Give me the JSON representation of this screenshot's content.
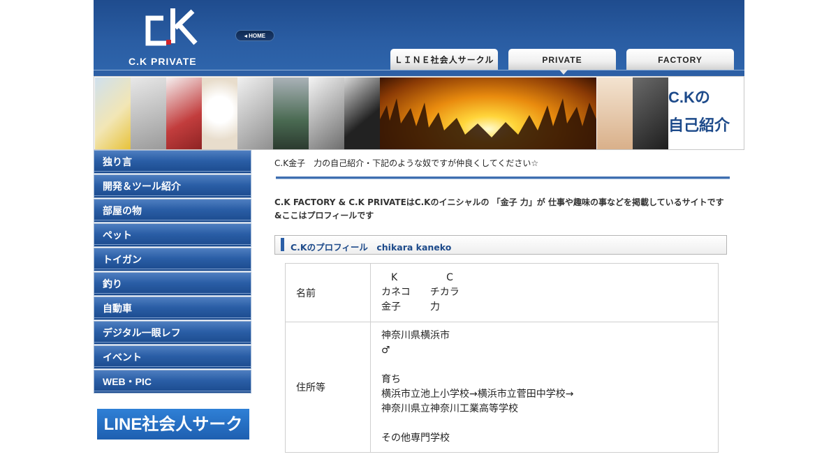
{
  "header": {
    "logo_text": "C.K PRIVATE",
    "home_label": "HOME",
    "tabs": [
      {
        "label": "ＬＩＮＥ社会人サークル"
      },
      {
        "label": "PRIVATE"
      },
      {
        "label": "FACTORY"
      }
    ],
    "colors": {
      "header_blue": "#1f4c8e",
      "accent_red": "#d0232b"
    }
  },
  "banner": {
    "title_line1": "C.Kの",
    "title_line2": "自己紹介"
  },
  "sidebar": {
    "items": [
      {
        "label": "独り言"
      },
      {
        "label": "開発＆ツール紹介"
      },
      {
        "label": "部屋の物"
      },
      {
        "label": "ペット"
      },
      {
        "label": "トイガン"
      },
      {
        "label": "釣り"
      },
      {
        "label": "自動車"
      },
      {
        "label": "デジタル一眼レフ"
      },
      {
        "label": "イベント"
      },
      {
        "label": "WEB・PIC"
      }
    ],
    "banner_label": "LINE社会人サークル"
  },
  "main": {
    "intro": "C.K金子　力の自己紹介・下記のような奴ですが仲良くしてください☆",
    "description": "C.K FACTORY & C.K PRIVATEはC.Kのイニシャルの 「金子 力」が 仕事や趣味の事などを掲載しているサイトです &ここはプロフィールです",
    "section_title": "C.Kのプロフィール　chikara kaneko",
    "profile": {
      "rows": [
        {
          "label": "名前",
          "lines": [
            "　K　　　　　C",
            "カネコ　　チカラ",
            "金子　　　力"
          ]
        },
        {
          "label": "住所等",
          "lines": [
            "神奈川県横浜市",
            "♂",
            "",
            "育ち",
            "横浜市立池上小学校→横浜市立菅田中学校→",
            "神奈川県立神奈川工業高等学校",
            "",
            "その他専門学校"
          ]
        }
      ]
    }
  }
}
